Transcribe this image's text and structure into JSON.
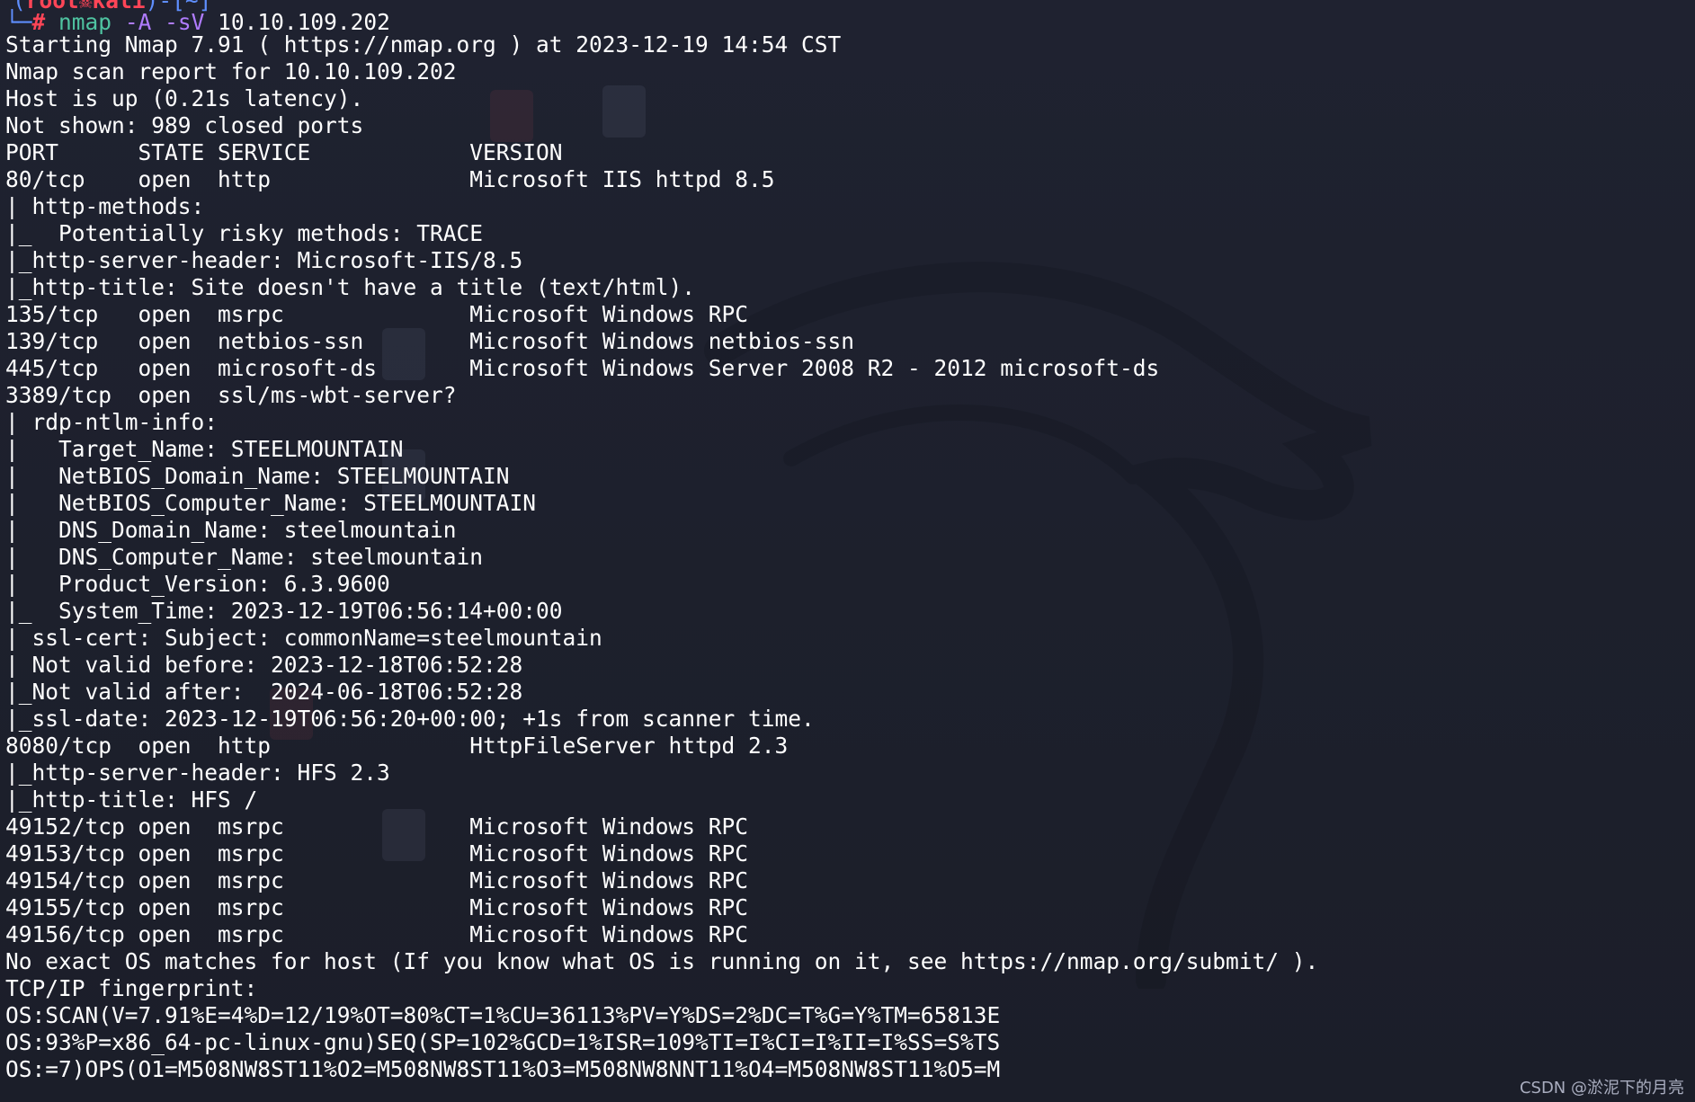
{
  "prompt": {
    "top_left": "(",
    "user": "root",
    "skull_icon": "☠",
    "host": "kali",
    "top_right": ")-[~]",
    "corner": "└─",
    "hash": "#",
    "program": "nmap",
    "flags": "-A -sV",
    "target": "10.10.109.202"
  },
  "output_lines": [
    "Starting Nmap 7.91 ( https://nmap.org ) at 2023-12-19 14:54 CST",
    "Nmap scan report for 10.10.109.202",
    "Host is up (0.21s latency).",
    "Not shown: 989 closed ports",
    "PORT      STATE SERVICE            VERSION",
    "80/tcp    open  http               Microsoft IIS httpd 8.5",
    "| http-methods:",
    "|_  Potentially risky methods: TRACE",
    "|_http-server-header: Microsoft-IIS/8.5",
    "|_http-title: Site doesn't have a title (text/html).",
    "135/tcp   open  msrpc              Microsoft Windows RPC",
    "139/tcp   open  netbios-ssn        Microsoft Windows netbios-ssn",
    "445/tcp   open  microsoft-ds       Microsoft Windows Server 2008 R2 - 2012 microsoft-ds",
    "3389/tcp  open  ssl/ms-wbt-server?",
    "| rdp-ntlm-info:",
    "|   Target_Name: STEELMOUNTAIN",
    "|   NetBIOS_Domain_Name: STEELMOUNTAIN",
    "|   NetBIOS_Computer_Name: STEELMOUNTAIN",
    "|   DNS_Domain_Name: steelmountain",
    "|   DNS_Computer_Name: steelmountain",
    "|   Product_Version: 6.3.9600",
    "|_  System_Time: 2023-12-19T06:56:14+00:00",
    "| ssl-cert: Subject: commonName=steelmountain",
    "| Not valid before: 2023-12-18T06:52:28",
    "|_Not valid after:  2024-06-18T06:52:28",
    "|_ssl-date: 2023-12-19T06:56:20+00:00; +1s from scanner time.",
    "8080/tcp  open  http               HttpFileServer httpd 2.3",
    "|_http-server-header: HFS 2.3",
    "|_http-title: HFS /",
    "49152/tcp open  msrpc              Microsoft Windows RPC",
    "49153/tcp open  msrpc              Microsoft Windows RPC",
    "49154/tcp open  msrpc              Microsoft Windows RPC",
    "49155/tcp open  msrpc              Microsoft Windows RPC",
    "49156/tcp open  msrpc              Microsoft Windows RPC",
    "No exact OS matches for host (If you know what OS is running on it, see https://nmap.org/submit/ ).",
    "TCP/IP fingerprint:",
    "OS:SCAN(V=7.91%E=4%D=12/19%OT=80%CT=1%CU=36113%PV=Y%DS=2%DC=T%G=Y%TM=65813E",
    "OS:93%P=x86_64-pc-linux-gnu)SEQ(SP=102%GCD=1%ISR=109%TI=I%CI=I%II=I%SS=S%TS",
    "OS:=7)OPS(O1=M508NW8ST11%O2=M508NW8ST11%O3=M508NW8NNT11%O4=M508NW8ST11%O5=M"
  ],
  "watermark": "CSDN @淤泥下的月亮",
  "colors": {
    "background": "#1c1f2b",
    "text": "#ffffff",
    "prompt_blue": "#5f8fff",
    "prompt_red": "#ff4557",
    "command_green": "#4fc3a1",
    "flag_purple": "#b07cff"
  }
}
